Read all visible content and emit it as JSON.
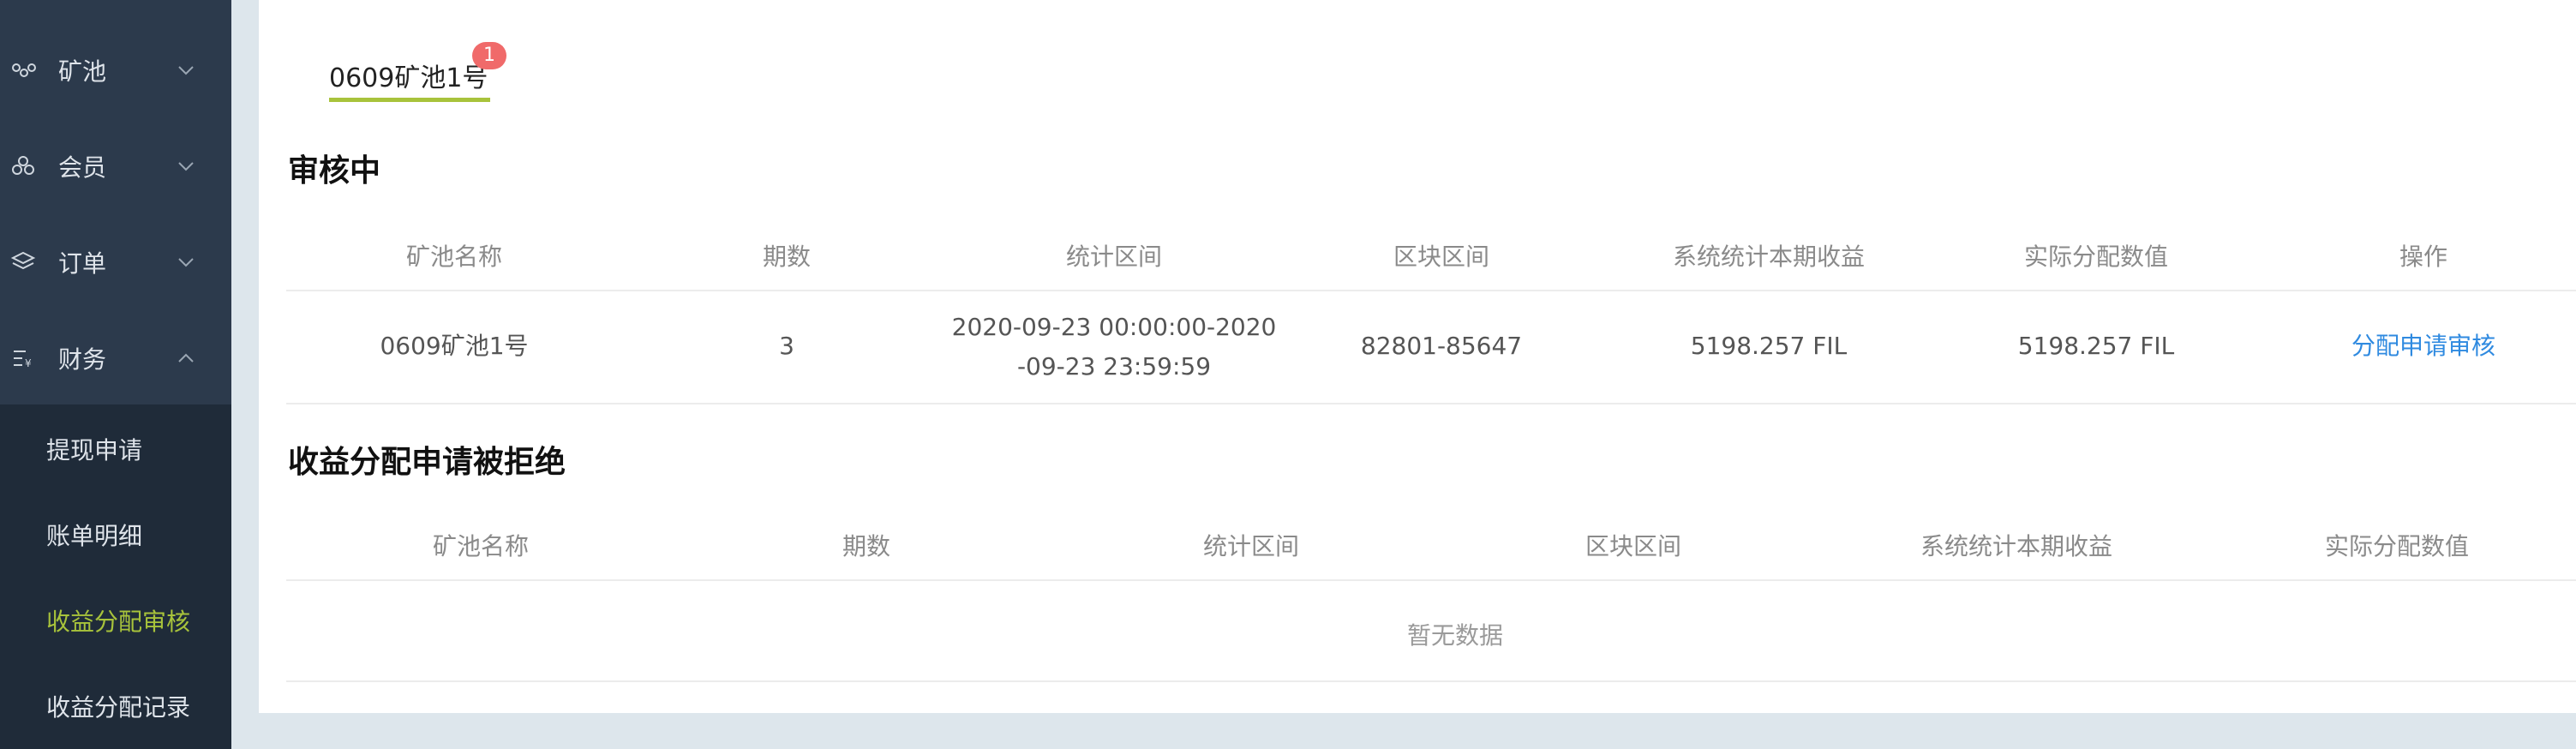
{
  "sidebar": {
    "menu": [
      {
        "label": "矿池",
        "icon": "pool-icon",
        "expanded": false
      },
      {
        "label": "会员",
        "icon": "members-icon",
        "expanded": false
      },
      {
        "label": "订单",
        "icon": "layers-icon",
        "expanded": false
      },
      {
        "label": "财务",
        "icon": "finance-icon",
        "expanded": true
      }
    ],
    "submenu": [
      {
        "label": "提现申请",
        "active": false
      },
      {
        "label": "账单明细",
        "active": false
      },
      {
        "label": "收益分配审核",
        "active": true
      },
      {
        "label": "收益分配记录",
        "active": false
      }
    ],
    "colors": {
      "bg": "#2c3a4c",
      "submenu_bg": "#1f2b39",
      "active": "#a8c33b"
    }
  },
  "tabs": [
    {
      "label": "0609矿池1号",
      "badge": "1"
    }
  ],
  "reviewing": {
    "title": "审核中",
    "columns": [
      "矿池名称",
      "期数",
      "统计区间",
      "区块区间",
      "系统统计本期收益",
      "实际分配数值",
      "操作"
    ],
    "rows": [
      {
        "pool": "0609矿池1号",
        "period": "3",
        "range_line1": "2020-09-23 00:00:00-2020",
        "range_line2": "-09-23 23:59:59",
        "blocks": "82801-85647",
        "system_income": "5198.257 FIL",
        "actual": "5198.257 FIL",
        "action": "分配申请审核"
      }
    ]
  },
  "rejected": {
    "title": "收益分配申请被拒绝",
    "columns": [
      "矿池名称",
      "期数",
      "统计区间",
      "区块区间",
      "系统统计本期收益",
      "实际分配数值"
    ],
    "empty_text": "暂无数据"
  },
  "colors": {
    "link": "#2f8ae0",
    "badge": "#f06a6a",
    "accent": "#a8c33b"
  }
}
